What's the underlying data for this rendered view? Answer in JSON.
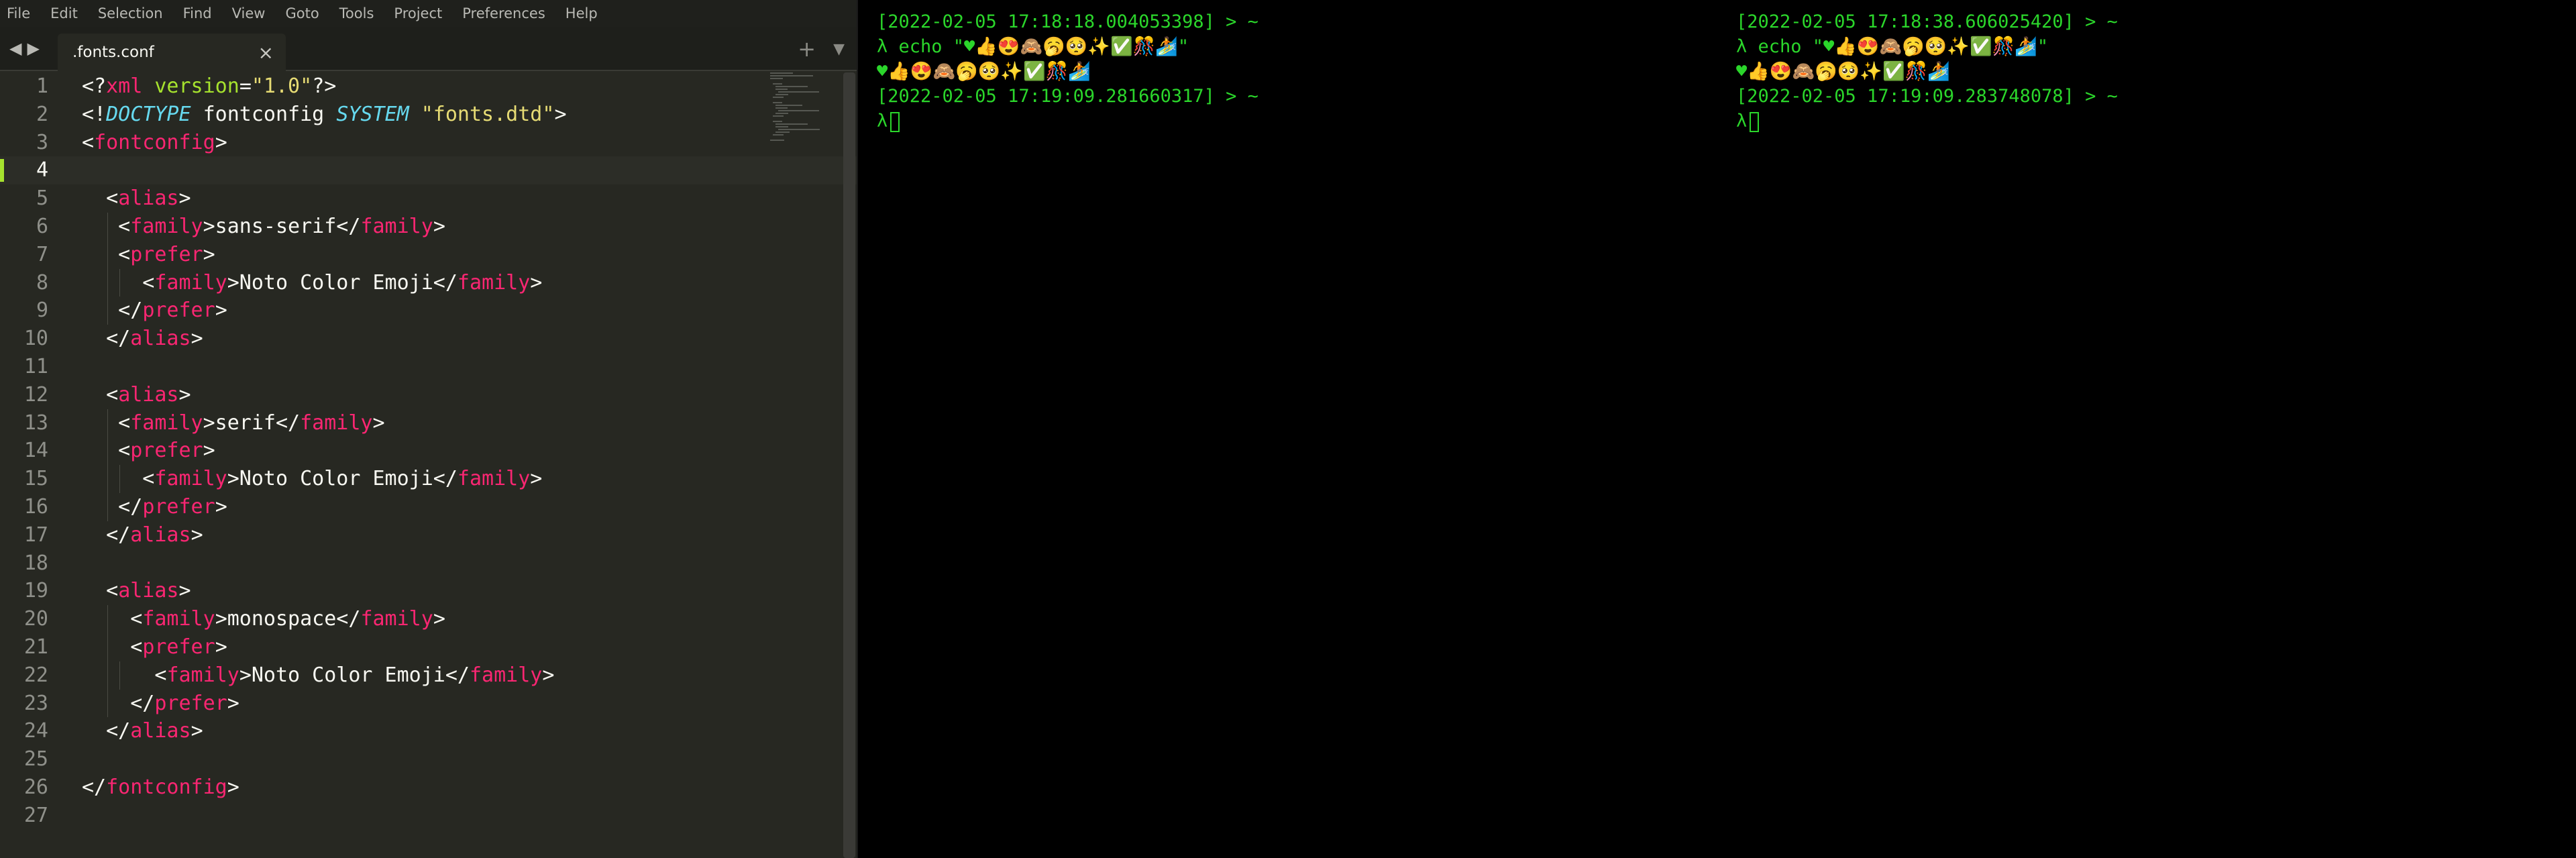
{
  "editor": {
    "menu": [
      "File",
      "Edit",
      "Selection",
      "Find",
      "View",
      "Goto",
      "Tools",
      "Project",
      "Preferences",
      "Help"
    ],
    "tab": {
      "label": ".fonts.conf",
      "close": "×"
    },
    "current_line": 4,
    "lines": [
      {
        "n": "1",
        "indent": 0,
        "html": "&lt;?<span class='tag'>xml</span> <span class='atr'>version</span>=<span class='str'>\"1.0\"</span>?&gt;"
      },
      {
        "n": "2",
        "indent": 0,
        "html": "&lt;!<span class='kw'>DOCTYPE</span> fontconfig <span class='kw'>SYSTEM</span> <span class='str'>\"fonts.dtd\"</span>&gt;"
      },
      {
        "n": "3",
        "indent": 0,
        "html": "&lt;<span class='tag'>fontconfig</span>&gt;"
      },
      {
        "n": "4",
        "indent": 0,
        "html": ""
      },
      {
        "n": "5",
        "indent": 1,
        "html": "  &lt;<span class='tag'>alias</span>&gt;"
      },
      {
        "n": "6",
        "indent": 2,
        "html": "   &lt;<span class='tag'>family</span>&gt;sans-serif&lt;/<span class='tag'>family</span>&gt;"
      },
      {
        "n": "7",
        "indent": 2,
        "html": "   &lt;<span class='tag'>prefer</span>&gt;"
      },
      {
        "n": "8",
        "indent": 3,
        "html": "     &lt;<span class='tag'>family</span>&gt;Noto Color Emoji&lt;/<span class='tag'>family</span>&gt;"
      },
      {
        "n": "9",
        "indent": 2,
        "html": "   &lt;/<span class='tag'>prefer</span>&gt;"
      },
      {
        "n": "10",
        "indent": 1,
        "html": "  &lt;/<span class='tag'>alias</span>&gt;"
      },
      {
        "n": "11",
        "indent": 0,
        "html": ""
      },
      {
        "n": "12",
        "indent": 1,
        "html": "  &lt;<span class='tag'>alias</span>&gt;"
      },
      {
        "n": "13",
        "indent": 2,
        "html": "   &lt;<span class='tag'>family</span>&gt;serif&lt;/<span class='tag'>family</span>&gt;"
      },
      {
        "n": "14",
        "indent": 2,
        "html": "   &lt;<span class='tag'>prefer</span>&gt;"
      },
      {
        "n": "15",
        "indent": 3,
        "html": "     &lt;<span class='tag'>family</span>&gt;Noto Color Emoji&lt;/<span class='tag'>family</span>&gt;"
      },
      {
        "n": "16",
        "indent": 2,
        "html": "   &lt;/<span class='tag'>prefer</span>&gt;"
      },
      {
        "n": "17",
        "indent": 1,
        "html": "  &lt;/<span class='tag'>alias</span>&gt;"
      },
      {
        "n": "18",
        "indent": 0,
        "html": ""
      },
      {
        "n": "19",
        "indent": 1,
        "html": "  &lt;<span class='tag'>alias</span>&gt;"
      },
      {
        "n": "20",
        "indent": 2,
        "html": "    &lt;<span class='tag'>family</span>&gt;monospace&lt;/<span class='tag'>family</span>&gt;"
      },
      {
        "n": "21",
        "indent": 2,
        "html": "    &lt;<span class='tag'>prefer</span>&gt;"
      },
      {
        "n": "22",
        "indent": 3,
        "html": "      &lt;<span class='tag'>family</span>&gt;Noto Color Emoji&lt;/<span class='tag'>family</span>&gt;"
      },
      {
        "n": "23",
        "indent": 2,
        "html": "    &lt;/<span class='tag'>prefer</span>&gt;"
      },
      {
        "n": "24",
        "indent": 1,
        "html": "  &lt;/<span class='tag'>alias</span>&gt;"
      },
      {
        "n": "25",
        "indent": 0,
        "html": ""
      },
      {
        "n": "26",
        "indent": 0,
        "html": "&lt;/<span class='tag'>fontconfig</span>&gt;"
      },
      {
        "n": "27",
        "indent": 0,
        "html": ""
      }
    ]
  },
  "terminal_left": {
    "lines": [
      "[2022-02-05 17:18:18.004053398] > ~",
      "λ echo \"♥👍😍🙈🥱🥺✨✅🎊🏄\"",
      "♥👍😍🙈🥱🥺✨✅🎊🏄",
      "[2022-02-05 17:19:09.281660317] > ~"
    ],
    "prompt": "λ"
  },
  "terminal_right": {
    "lines": [
      "[2022-02-05 17:18:38.606025420] > ~",
      "λ echo \"♥👍😍🙈🥱🥺✨✅🎊🏄\"",
      "♥👍😍🙈🥱🥺✨✅🎊🏄",
      "[2022-02-05 17:19:09.283748078] > ~"
    ],
    "prompt": "λ"
  },
  "colors": {
    "editor_bg": "#272822",
    "tag": "#f92672",
    "string": "#e6db74",
    "keyword": "#66d9ef",
    "attribute": "#a6e22e",
    "terminal_fg": "#2bd62b"
  },
  "icons": {
    "tab_prev": "chevron-left-icon",
    "tab_next": "chevron-right-icon",
    "tab_close": "close-icon",
    "new_tab": "plus-icon",
    "tab_menu": "dropdown-icon"
  }
}
